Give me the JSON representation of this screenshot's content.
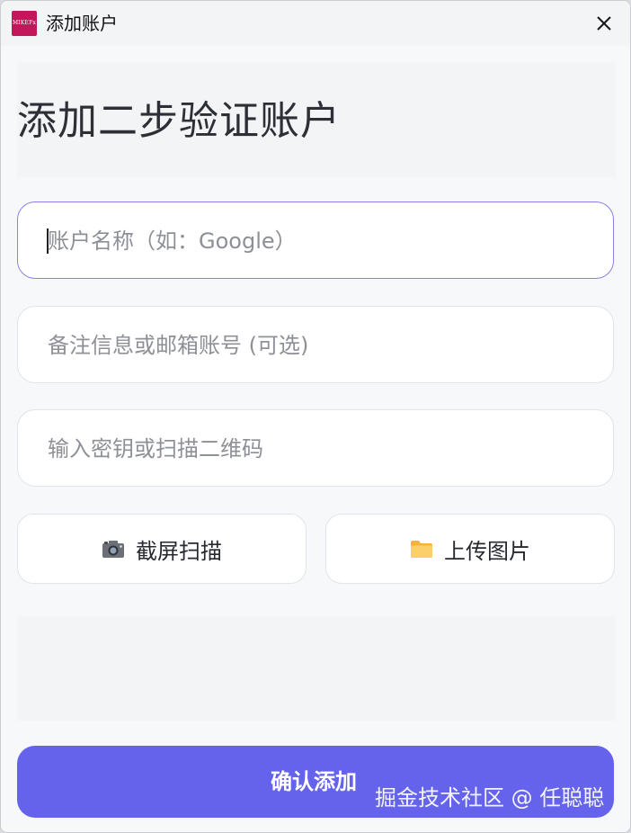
{
  "window": {
    "title": "添加账户",
    "app_icon_text": "MIKEFx",
    "close_icon": "close-icon"
  },
  "heading": "添加二步验证账户",
  "fields": {
    "account_name": {
      "placeholder": "账户名称（如：Google）",
      "value": ""
    },
    "note": {
      "placeholder": "备注信息或邮箱账号 (可选)",
      "value": ""
    },
    "secret": {
      "placeholder": "输入密钥或扫描二维码",
      "value": ""
    }
  },
  "buttons": {
    "screenshot_scan": {
      "label": "截屏扫描",
      "icon": "camera-icon"
    },
    "upload_image": {
      "label": "上传图片",
      "icon": "folder-icon"
    },
    "confirm": {
      "label": "确认添加"
    }
  },
  "watermark": "掘金技术社区 @ 任聪聪",
  "colors": {
    "accent": "#6563ec",
    "focus_border": "#8b80e6",
    "app_icon": "#c2185b",
    "window_bg": "#f7f8fa",
    "panel_bg": "#f3f4f6"
  }
}
